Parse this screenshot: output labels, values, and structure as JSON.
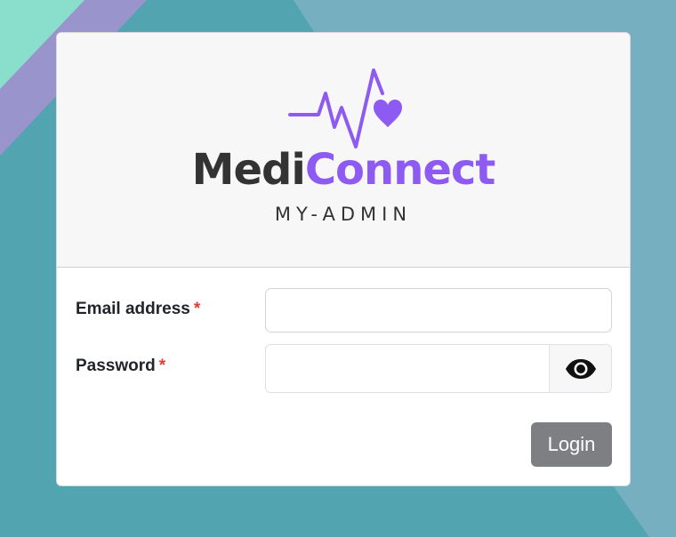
{
  "brand": {
    "name_part1": "Medi",
    "name_part2": "Connect",
    "subtitle": "MY-ADMIN",
    "logo_icon": "heartbeat-heart-icon"
  },
  "form": {
    "email_label": "Email address",
    "email_value": "",
    "email_placeholder": "",
    "password_label": "Password",
    "password_value": "",
    "password_placeholder": "",
    "required_marker": "*",
    "toggle_icon": "eye-icon",
    "login_label": "Login"
  },
  "colors": {
    "background": "#53a4b1",
    "accent_purple": "#8d5bf2",
    "brand_dark": "#333333",
    "required": "#e53935",
    "login_button": "#7d7f82"
  }
}
